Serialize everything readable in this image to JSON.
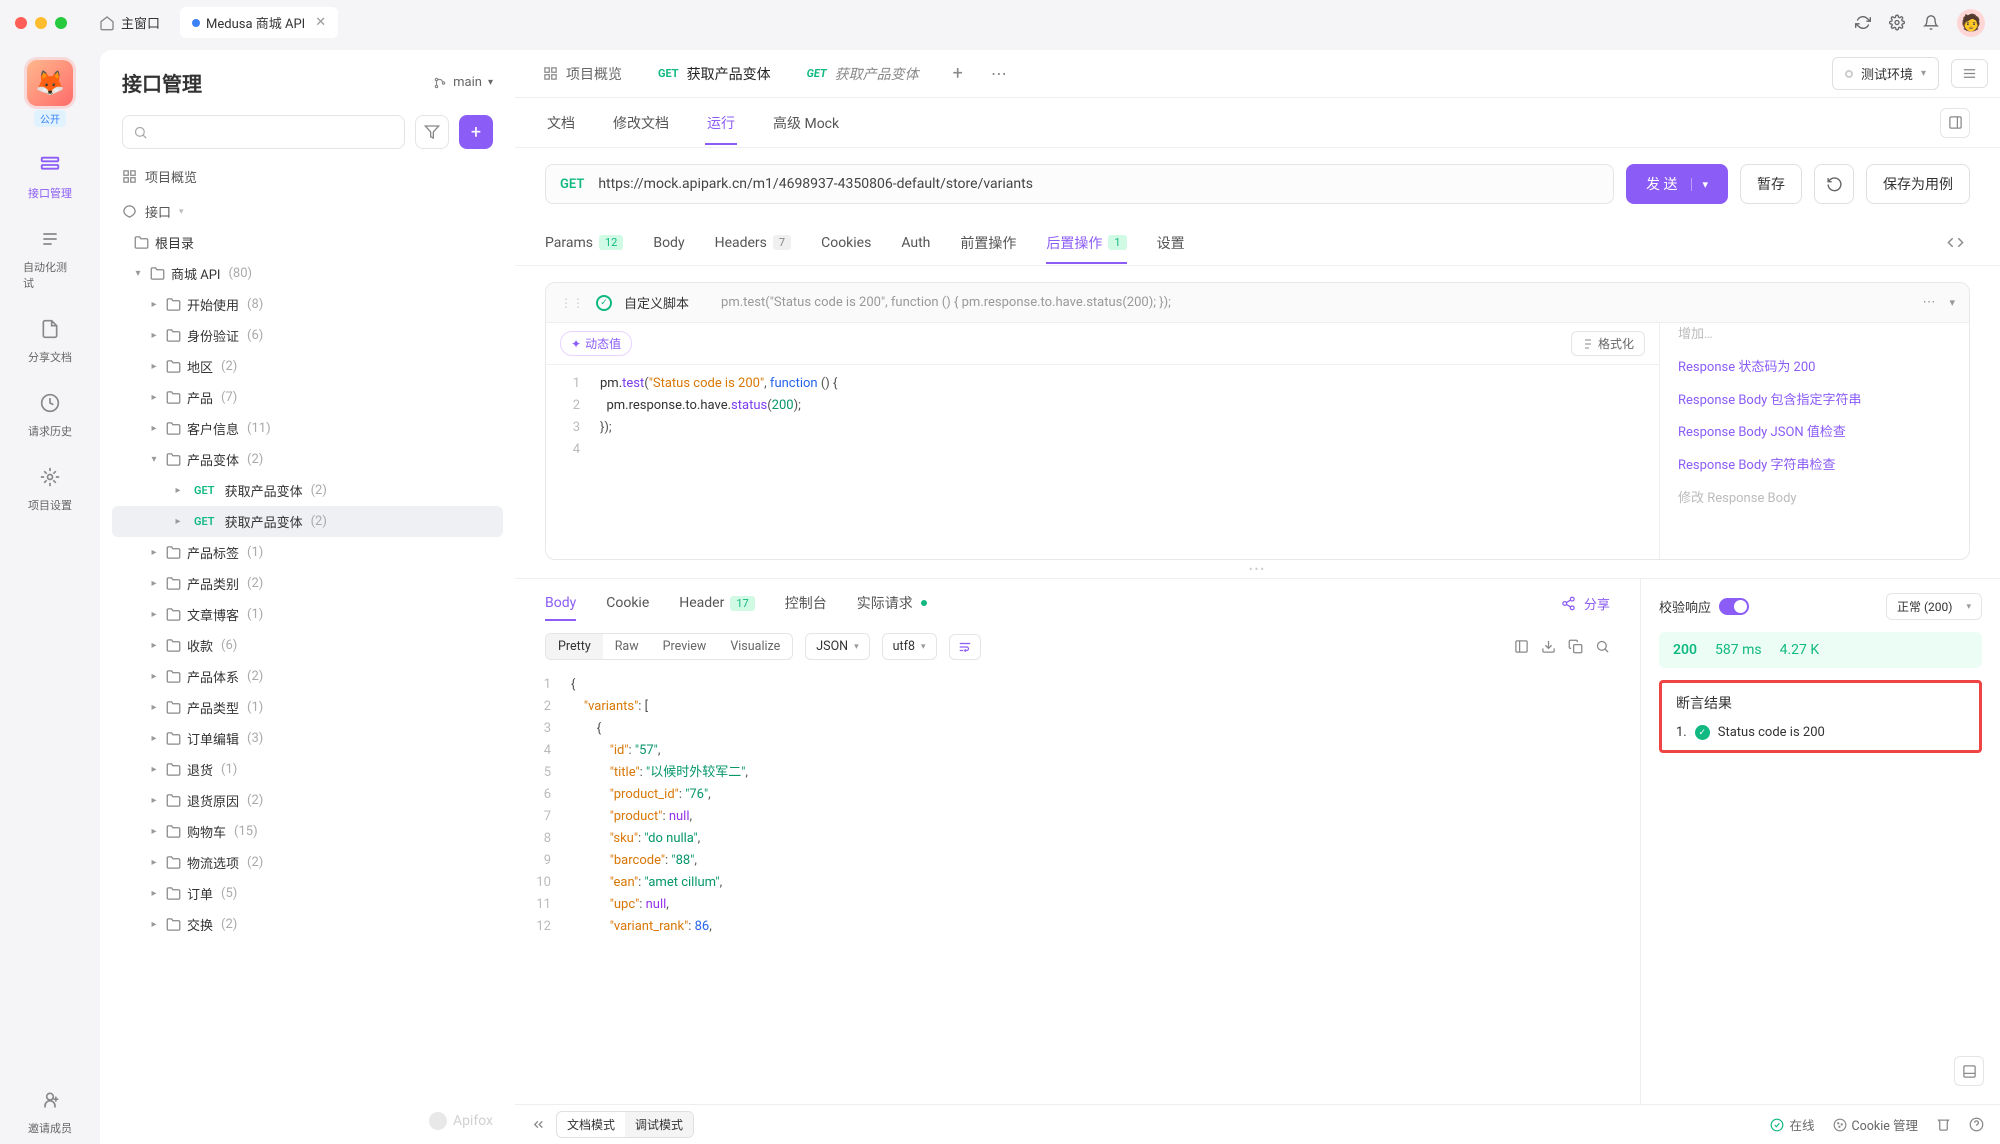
{
  "titlebar": {
    "home_label": "主窗口",
    "active_tab": "Medusa 商城 API"
  },
  "leftRail": {
    "pub_badge": "公开",
    "items": [
      {
        "label": "接口管理"
      },
      {
        "label": "自动化测试"
      },
      {
        "label": "分享文档"
      },
      {
        "label": "请求历史"
      },
      {
        "label": "项目设置"
      }
    ],
    "invite": "邀请成员"
  },
  "sidebar": {
    "title": "接口管理",
    "branch": "main",
    "search_placeholder": "",
    "overview": "项目概览",
    "api_section": "接口",
    "tree": [
      {
        "l": 0,
        "exp": "",
        "t": "folder",
        "label": "根目录",
        "count": ""
      },
      {
        "l": 1,
        "exp": "v",
        "t": "folder",
        "label": "商城 API",
        "count": "(80)"
      },
      {
        "l": 2,
        "exp": ">",
        "t": "folder",
        "label": "开始使用",
        "count": "(8)"
      },
      {
        "l": 2,
        "exp": ">",
        "t": "folder",
        "label": "身份验证",
        "count": "(6)"
      },
      {
        "l": 2,
        "exp": ">",
        "t": "folder",
        "label": "地区",
        "count": "(2)"
      },
      {
        "l": 2,
        "exp": ">",
        "t": "folder",
        "label": "产品",
        "count": "(7)"
      },
      {
        "l": 2,
        "exp": ">",
        "t": "folder",
        "label": "客户信息",
        "count": "(11)"
      },
      {
        "l": 2,
        "exp": "v",
        "t": "folder",
        "label": "产品变体",
        "count": "(2)"
      },
      {
        "l": 3,
        "exp": ">",
        "t": "api",
        "method": "GET",
        "label": "获取产品变体",
        "count": "(2)"
      },
      {
        "l": 3,
        "exp": ">",
        "t": "api",
        "method": "GET",
        "label": "获取产品变体",
        "count": "(2)",
        "sel": true
      },
      {
        "l": 2,
        "exp": ">",
        "t": "folder",
        "label": "产品标签",
        "count": "(1)"
      },
      {
        "l": 2,
        "exp": ">",
        "t": "folder",
        "label": "产品类别",
        "count": "(2)"
      },
      {
        "l": 2,
        "exp": ">",
        "t": "folder",
        "label": "文章博客",
        "count": "(1)"
      },
      {
        "l": 2,
        "exp": ">",
        "t": "folder",
        "label": "收款",
        "count": "(6)"
      },
      {
        "l": 2,
        "exp": ">",
        "t": "folder",
        "label": "产品体系",
        "count": "(2)"
      },
      {
        "l": 2,
        "exp": ">",
        "t": "folder",
        "label": "产品类型",
        "count": "(1)"
      },
      {
        "l": 2,
        "exp": ">",
        "t": "folder",
        "label": "订单编辑",
        "count": "(3)"
      },
      {
        "l": 2,
        "exp": ">",
        "t": "folder",
        "label": "退货",
        "count": "(1)"
      },
      {
        "l": 2,
        "exp": ">",
        "t": "folder",
        "label": "退货原因",
        "count": "(2)"
      },
      {
        "l": 2,
        "exp": ">",
        "t": "folder",
        "label": "购物车",
        "count": "(15)"
      },
      {
        "l": 2,
        "exp": ">",
        "t": "folder",
        "label": "物流选项",
        "count": "(2)"
      },
      {
        "l": 2,
        "exp": ">",
        "t": "folder",
        "label": "订单",
        "count": "(5)"
      },
      {
        "l": 2,
        "exp": ">",
        "t": "folder",
        "label": "交换",
        "count": "(2)"
      }
    ],
    "watermark": "Apifox"
  },
  "main": {
    "tabs": [
      {
        "icon": "overview",
        "label": "项目概览"
      },
      {
        "method": "GET",
        "label": "获取产品变体",
        "active": true
      },
      {
        "method": "GET",
        "label": "获取产品变体",
        "italic": true
      }
    ],
    "env_label": "测试环境",
    "subtabs": [
      "文档",
      "修改文档",
      "运行",
      "高级 Mock"
    ],
    "subtab_active": 2,
    "request": {
      "method": "GET",
      "url": "https://mock.apipark.cn/m1/4698937-4350806-default/store/variants",
      "send": "发 送",
      "save_draft": "暂存",
      "save_case": "保存为用例"
    },
    "reqTabs": {
      "items": [
        {
          "label": "Params",
          "badge": "12",
          "badgeClass": "green"
        },
        {
          "label": "Body"
        },
        {
          "label": "Headers",
          "badge": "7"
        },
        {
          "label": "Cookies"
        },
        {
          "label": "Auth"
        },
        {
          "label": "前置操作"
        },
        {
          "label": "后置操作",
          "badge": "1",
          "badgeClass": "green",
          "active": true
        },
        {
          "label": "设置"
        }
      ]
    },
    "script": {
      "title": "自定义脚本",
      "preview": "pm.test(\"Status code is 200\", function () { pm.response.to.have.status(200); });",
      "dyn_chip": "动态值",
      "fmt_chip": "格式化",
      "lines": [
        "1",
        "2",
        "3",
        "4"
      ],
      "code": {
        "l1_pre": "pm.",
        "l1_fn": "test",
        "l1_str": "\"Status code is 200\"",
        "l1_kw": "function",
        "l2_pre": "  pm.response.to.have.",
        "l2_fn": "status",
        "l2_num": "200",
        "l3": "});"
      },
      "snippets_partial_top": "增加…",
      "snippets": [
        "Response 状态码为 200",
        "Response Body 包含指定字符串",
        "Response Body JSON 值检查",
        "Response Body 字符串检查"
      ],
      "snippets_partial_bottom": "修改 Response Body"
    },
    "response": {
      "tabs": [
        {
          "label": "Body",
          "active": true
        },
        {
          "label": "Cookie"
        },
        {
          "label": "Header",
          "badge": "17"
        },
        {
          "label": "控制台"
        },
        {
          "label": "实际请求",
          "dot": true
        }
      ],
      "share": "分享",
      "seg": [
        "Pretty",
        "Raw",
        "Preview",
        "Visualize"
      ],
      "seg_active": 0,
      "fmt_json": "JSON",
      "fmt_enc": "utf8",
      "json_lines": [
        "1",
        "2",
        "3",
        "4",
        "5",
        "6",
        "7",
        "8",
        "9",
        "10",
        "11",
        "12"
      ],
      "json": {
        "variants_key": "\"variants\"",
        "id_k": "\"id\"",
        "id_v": "\"57\"",
        "title_k": "\"title\"",
        "title_v": "\"以候时外较军二\"",
        "pid_k": "\"product_id\"",
        "pid_v": "\"76\"",
        "prod_k": "\"product\"",
        "prod_v": "null",
        "sku_k": "\"sku\"",
        "sku_v": "\"do nulla\"",
        "bc_k": "\"barcode\"",
        "bc_v": "\"88\"",
        "ean_k": "\"ean\"",
        "ean_v": "\"amet cillum\"",
        "upc_k": "\"upc\"",
        "upc_v": "null",
        "vr_k": "\"variant_rank\"",
        "vr_v": "86"
      }
    },
    "rightPanel": {
      "verify_label": "校验响应",
      "status_sel": "正常 (200)",
      "status_code": "200",
      "time": "587 ms",
      "size": "4.27 K",
      "assert_title": "断言结果",
      "assert_idx": "1.",
      "assert_text": "Status code is 200"
    },
    "statusbar": {
      "mode_doc": "文档模式",
      "mode_debug": "调试模式",
      "online": "在线",
      "cookie": "Cookie 管理"
    }
  }
}
